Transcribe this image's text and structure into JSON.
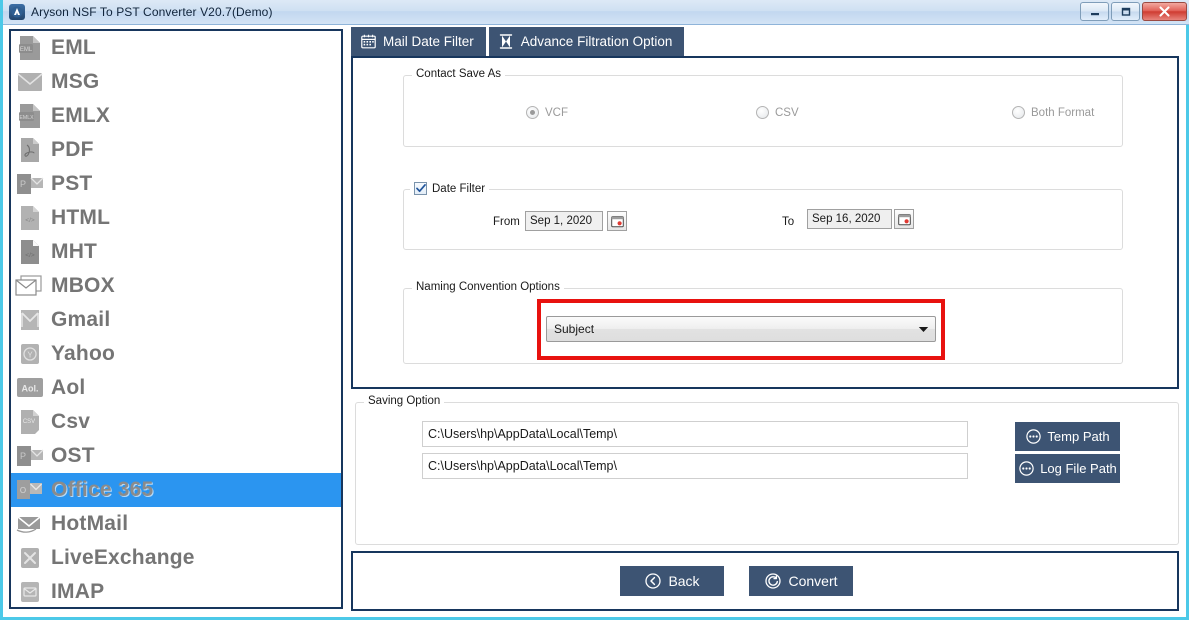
{
  "window": {
    "title": "Aryson NSF To PST Converter V20.7(Demo)",
    "app_icon": "aryson-logo-icon",
    "controls": [
      {
        "name": "minimize-button",
        "glyph": "minimize-icon"
      },
      {
        "name": "maximize-button",
        "glyph": "maximize-icon"
      },
      {
        "name": "close-button",
        "glyph": "close-icon"
      }
    ],
    "accent_border": "#4cc9e8",
    "panel_border": "#17365d"
  },
  "sidebar": {
    "selected": "Office 365",
    "selected_color": "#2b95f0",
    "items": [
      {
        "label": "EML",
        "icon": "eml-file-icon"
      },
      {
        "label": "MSG",
        "icon": "msg-envelope-icon"
      },
      {
        "label": "EMLX",
        "icon": "emlx-file-icon"
      },
      {
        "label": "PDF",
        "icon": "pdf-file-icon"
      },
      {
        "label": "PST",
        "icon": "pst-outlook-icon"
      },
      {
        "label": "HTML",
        "icon": "html-code-file-icon"
      },
      {
        "label": "MHT",
        "icon": "mht-code-file-icon"
      },
      {
        "label": "MBOX",
        "icon": "mbox-envelope-icon"
      },
      {
        "label": "Gmail",
        "icon": "gmail-icon"
      },
      {
        "label": "Yahoo",
        "icon": "yahoo-icon"
      },
      {
        "label": "Aol",
        "icon": "aol-icon"
      },
      {
        "label": "Csv",
        "icon": "csv-file-icon"
      },
      {
        "label": "OST",
        "icon": "ost-outlook-icon"
      },
      {
        "label": "Office 365",
        "icon": "office365-icon"
      },
      {
        "label": "HotMail",
        "icon": "hotmail-icon"
      },
      {
        "label": "LiveExchange",
        "icon": "live-exchange-icon"
      },
      {
        "label": "IMAP",
        "icon": "imap-envelope-icon"
      }
    ]
  },
  "tabs": [
    {
      "label": "Mail Date Filter",
      "icon": "calendar-icon",
      "active": true
    },
    {
      "label": "Advance Filtration Option",
      "icon": "filter-funnel-icon",
      "active": false
    }
  ],
  "contact_save_as": {
    "title": "Contact Save As",
    "options": [
      {
        "label": "VCF",
        "selected": true
      },
      {
        "label": "CSV",
        "selected": false
      },
      {
        "label": "Both Format",
        "selected": false
      }
    ]
  },
  "date_filter": {
    "title": "Date Filter",
    "checked": true,
    "from_label": "From",
    "from_value": "Sep 1, 2020",
    "to_label": "To",
    "to_value": "Sep 16, 2020",
    "calendar_icon": "calendar-picker-icon"
  },
  "naming_convention": {
    "title": "Naming Convention Options",
    "selected": "Subject",
    "highlight_color": "#e8120f",
    "dropdown_icon": "chevron-down-icon"
  },
  "saving_option": {
    "title": "Saving Option",
    "temp_path_value": "C:\\Users\\hp\\AppData\\Local\\Temp\\",
    "log_path_value": "C:\\Users\\hp\\AppData\\Local\\Temp\\",
    "temp_path_button": "Temp Path",
    "log_path_button": "Log File Path",
    "browse_icon": "ellipsis-circle-icon"
  },
  "footer": {
    "back_label": "Back",
    "back_icon": "back-chevron-circle-icon",
    "convert_label": "Convert",
    "convert_icon": "convert-circle-icon"
  }
}
